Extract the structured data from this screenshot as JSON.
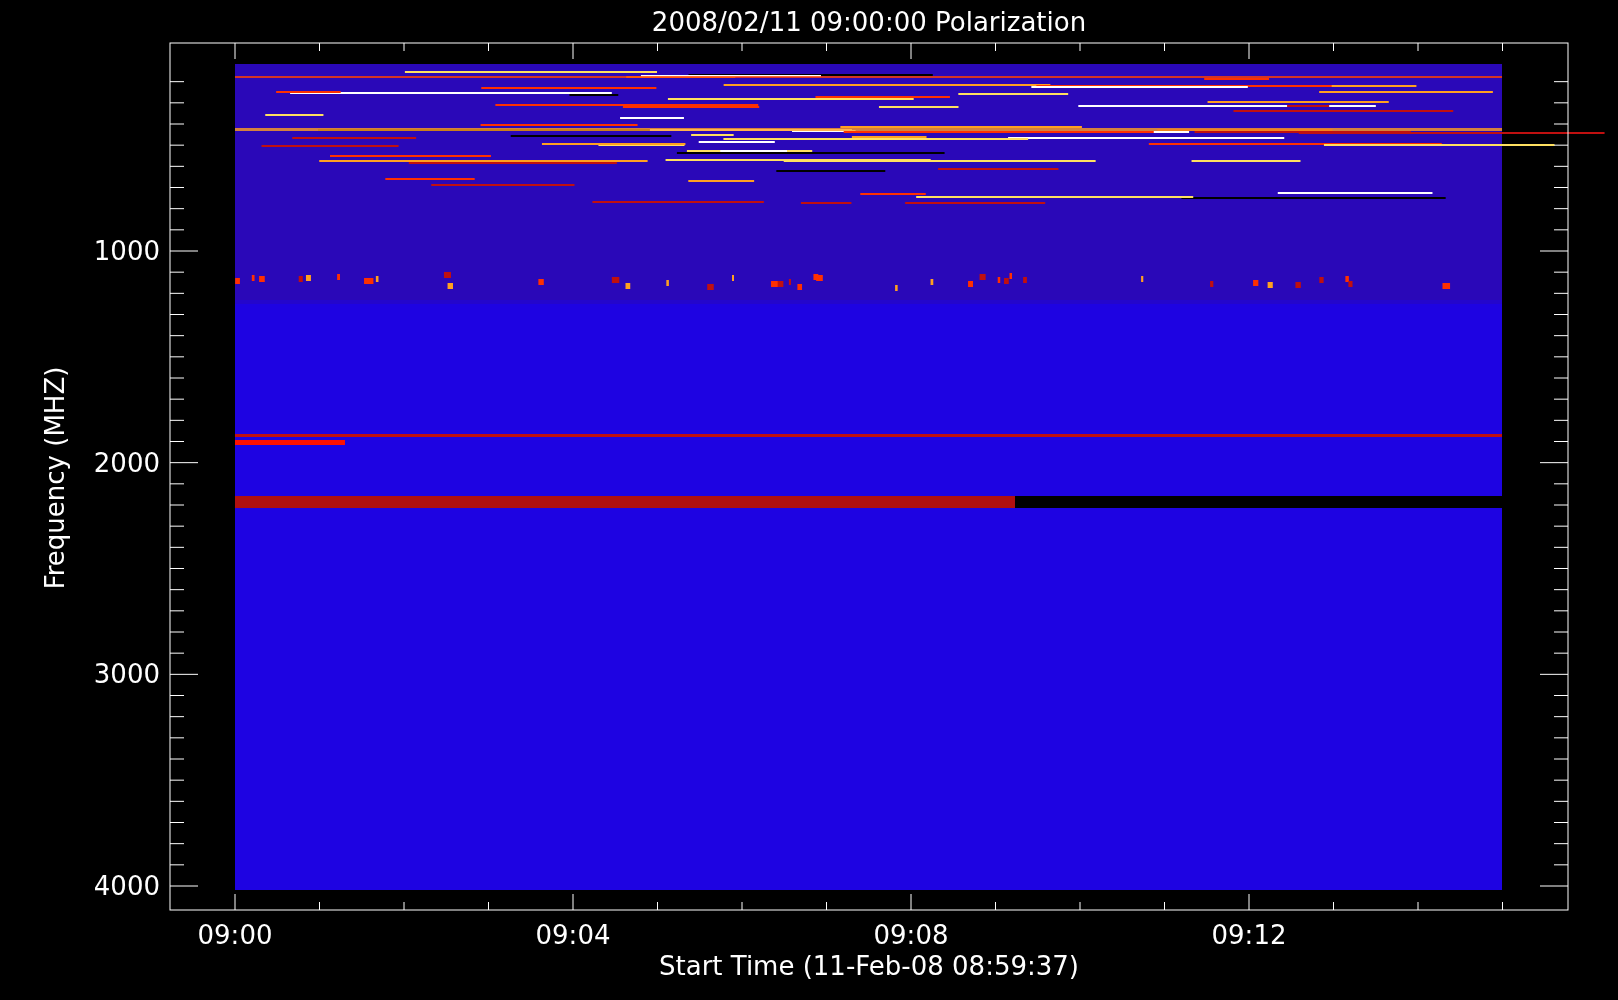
{
  "title": "2008/02/11 09:00:00 Polarization",
  "ylabel": "Frequency (MHZ)",
  "xlabel": "Start Time (11-Feb-08 08:59:37)",
  "yticks": [
    "1000",
    "2000",
    "3000",
    "4000"
  ],
  "xticks": [
    "09:00",
    "09:04",
    "09:08",
    "09:12"
  ]
}
